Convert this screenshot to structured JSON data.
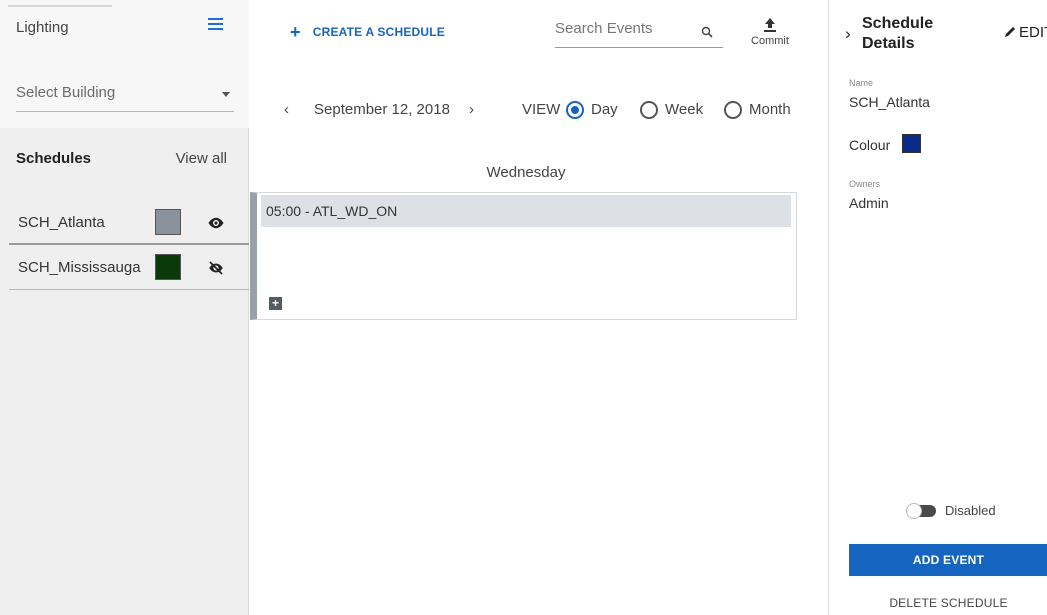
{
  "sidebar": {
    "title": "Lighting",
    "building_placeholder": "Select Building",
    "schedules_heading": "Schedules",
    "view_all": "View all",
    "schedules": [
      {
        "name": "SCH_Atlanta",
        "color": "#8a939c",
        "visibility": "visible"
      },
      {
        "name": "SCH_Mississauga",
        "color": "#0a3a0a",
        "visibility": "hidden"
      }
    ]
  },
  "toolbar": {
    "create_label": "CREATE A SCHEDULE",
    "search_placeholder": "Search Events",
    "commit_label": "Commit"
  },
  "calendar": {
    "date": "September 12, 2018",
    "view_label": "VIEW",
    "views": [
      "Day",
      "Week",
      "Month"
    ],
    "selected_view": "Day",
    "weekday": "Wednesday",
    "events": [
      {
        "label": "05:00 - ATL_WD_ON"
      }
    ]
  },
  "details": {
    "title_line1": "Schedule",
    "title_line2": "Details",
    "edit_label": "EDIT",
    "name_label": "Name",
    "name_value": "SCH_Atlanta",
    "colour_label": "Colour",
    "colour_value": "#0b2a8a",
    "owners_label": "Owners",
    "owners_value": "Admin",
    "toggle_label": "Disabled",
    "add_event_label": "ADD EVENT",
    "delete_label": "DELETE SCHEDULE"
  },
  "colors": {
    "accent": "#1565c0",
    "event_bg": "#dde0e4"
  }
}
